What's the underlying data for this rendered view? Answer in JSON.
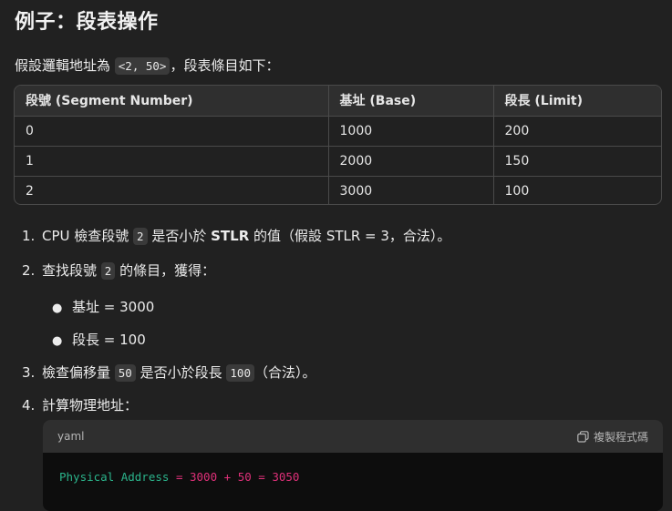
{
  "title": "例子：段表操作",
  "intro": {
    "before": "假設邏輯地址為 ",
    "code": "<2, 50>",
    "after": "，段表條目如下："
  },
  "table": {
    "headers": [
      "段號 (Segment Number)",
      "基址 (Base)",
      "段長 (Limit)"
    ],
    "rows": [
      [
        "0",
        "1000",
        "200"
      ],
      [
        "1",
        "2000",
        "150"
      ],
      [
        "2",
        "3000",
        "100"
      ]
    ]
  },
  "steps": {
    "s1": {
      "num": "1.",
      "a": "CPU 檢查段號 ",
      "code": "2",
      "b": " 是否小於 ",
      "bold": "STLR",
      "c": " 的值（假設 STLR = 3，合法）。"
    },
    "s2": {
      "num": "2.",
      "a": "查找段號 ",
      "code": "2",
      "b": " 的條目，獲得："
    },
    "bullets": [
      "基址 = 3000",
      "段長 = 100"
    ],
    "s3": {
      "num": "3.",
      "a": "檢查偏移量 ",
      "code1": "50",
      "b": " 是否小於段長 ",
      "code2": "100",
      "c": "（合法）。"
    },
    "s4": {
      "num": "4.",
      "a": "計算物理地址："
    }
  },
  "code_block": {
    "language": "yaml",
    "copy_label": "複製程式碼",
    "line": {
      "key": "Physical Address",
      "eq": " = ",
      "n1": "3000",
      "plus": " + ",
      "n2": "50",
      "eq2": " = ",
      "n3": "3050"
    }
  },
  "colors": {
    "background": "#212121",
    "key": "#2bb58c",
    "number": "#df3079"
  }
}
